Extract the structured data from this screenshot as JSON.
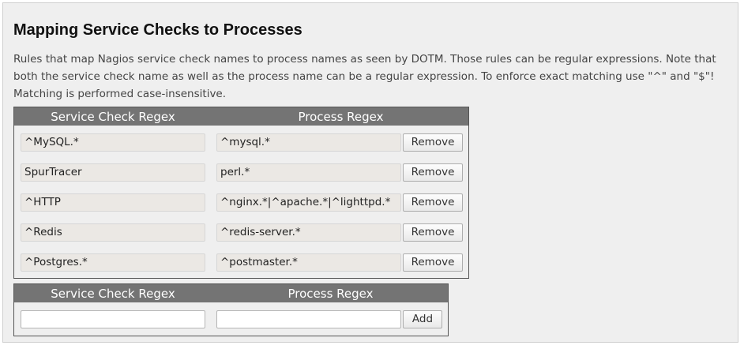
{
  "page": {
    "title": "Mapping Service Checks to Processes",
    "description": "Rules that map Nagios service check names to process names as seen by DOTM. Those rules can be regular expressions. Note that both the service check name as well as the process name can be a regular expression. To enforce exact matching use \"^\" and \"$\"! Matching is performed case-insensitive."
  },
  "mappings_table": {
    "headers": {
      "service_check": "Service Check Regex",
      "process": "Process Regex"
    },
    "rows": [
      {
        "service_check": "^MySQL.*",
        "process": "^mysql.*",
        "action": "Remove"
      },
      {
        "service_check": "SpurTracer",
        "process": "perl.*",
        "action": "Remove"
      },
      {
        "service_check": "^HTTP",
        "process": "^nginx.*|^apache.*|^lighttpd.*",
        "action": "Remove"
      },
      {
        "service_check": "^Redis",
        "process": "^redis-server.*",
        "action": "Remove"
      },
      {
        "service_check": "^Postgres.*",
        "process": "^postmaster.*",
        "action": "Remove"
      }
    ]
  },
  "add_table": {
    "headers": {
      "service_check": "Service Check Regex",
      "process": "Process Regex"
    },
    "service_check_value": "",
    "process_value": "",
    "add_label": "Add"
  },
  "colors": {
    "panel_background": "#efefef",
    "table_header": "#747474",
    "readonly_field": "#ebe8e4"
  }
}
